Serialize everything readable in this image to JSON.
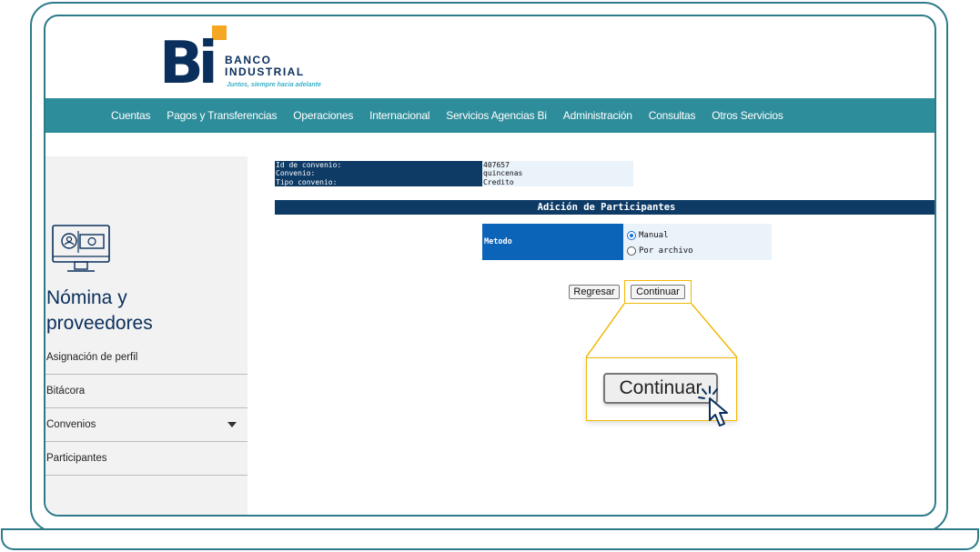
{
  "brand": {
    "logo_text": "Bi",
    "name_line1": "BANCO",
    "name_line2": "INDUSTRIAL",
    "tagline": "Juntos, siempre hacia adelante",
    "colors": {
      "navy": "#0a2f5c",
      "teal": "#2e8d9b",
      "orange": "#f5a623",
      "highlight": "#f2b705"
    }
  },
  "nav": {
    "items": [
      "Cuentas",
      "Pagos y Transferencias",
      "Operaciones",
      "Internacional",
      "Servicios Agencias Bi",
      "Administración",
      "Consultas",
      "Otros Servicios"
    ]
  },
  "sidebar": {
    "icon": "payroll-monitor-icon",
    "title_line1": "Nómina y",
    "title_line2": "proveedores",
    "items": [
      "Asignación de perfil",
      "Bitácora",
      "Convenios",
      "Participantes"
    ]
  },
  "agreement": {
    "rows": [
      {
        "label": "Id de convenio:",
        "value": "407657"
      },
      {
        "label": "Convenio:",
        "value": "quincenas"
      },
      {
        "label": "Tipo convenio:",
        "value": "Credito"
      }
    ]
  },
  "section": {
    "title": "Adición de Participantes"
  },
  "method": {
    "label": "Metodo",
    "options": [
      {
        "label": "Manual",
        "selected": true
      },
      {
        "label": "Por archivo",
        "selected": false
      }
    ]
  },
  "actions": {
    "back_label": "Regresar",
    "continue_label": "Continuar"
  },
  "callout": {
    "zoom_label": "Continuar",
    "cursor_icon": "hand-pointer-click-icon"
  }
}
